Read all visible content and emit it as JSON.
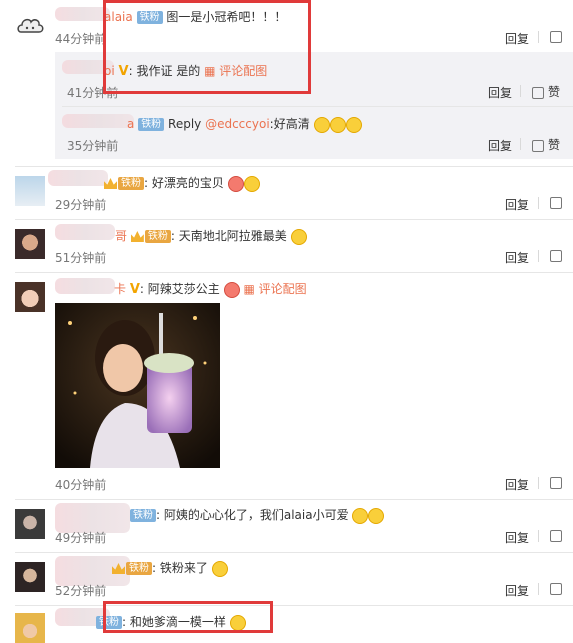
{
  "labels": {
    "reply": "回复",
    "like": "赞"
  },
  "colors": {
    "username": "#eb7350",
    "highlight_box": "#e03a3a",
    "fan_badge": "#7fb2de"
  },
  "comments": [
    {
      "user": "alaia",
      "badge": "铁粉",
      "text": "图一是小冠希吧！！！",
      "time": "44分钟前"
    },
    {
      "user": "oi",
      "text": "我作证 是的",
      "pic_link": "评论配图",
      "time": "41分钟前"
    },
    {
      "user": "a",
      "badge": "铁粉",
      "text_prefix": "Reply ",
      "mention": "@edcccyoi",
      "text": ":好高清",
      "time": "35分钟前"
    },
    {
      "user": "",
      "fan_badge": "铁粉",
      "text": "好漂亮的宝贝",
      "time": "29分钟前"
    },
    {
      "user": "哥",
      "fan_badge": "铁粉",
      "text": "天南地北阿拉雅最美",
      "time": "51分钟前"
    },
    {
      "user": "卡",
      "text": "阿辣艾莎公主",
      "pic_link": "评论配图",
      "time": "40分钟前"
    },
    {
      "user": "",
      "badge": "铁粉",
      "text": "阿姨的心心化了，我们alaia小可爱",
      "time": "49分钟前"
    },
    {
      "user": "",
      "fan_badge": "铁粉",
      "text": "铁粉来了",
      "time": "52分钟前"
    },
    {
      "user": "",
      "badge": "铁粉",
      "text": "和她爹滴一模一样",
      "time": ""
    }
  ]
}
